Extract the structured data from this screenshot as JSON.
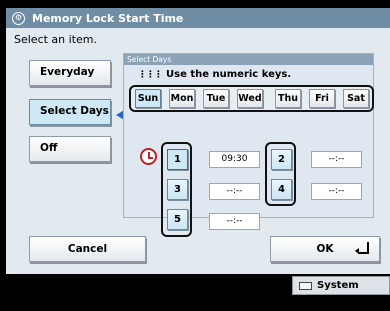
{
  "window": {
    "title": "Memory Lock Start Time"
  },
  "instruction": "Select an item.",
  "modes": [
    {
      "label": "Everyday",
      "selected": false
    },
    {
      "label": "Select Days",
      "selected": true
    },
    {
      "label": "Off",
      "selected": false
    }
  ],
  "select_days": {
    "header": "Select Days",
    "hint": "Use the numeric keys.",
    "days": [
      {
        "label": "Sun",
        "selected": true
      },
      {
        "label": "Mon",
        "selected": false
      },
      {
        "label": "Tue",
        "selected": false
      },
      {
        "label": "Wed",
        "selected": false
      },
      {
        "label": "Thu",
        "selected": false
      },
      {
        "label": "Fri",
        "selected": false
      },
      {
        "label": "Sat",
        "selected": false
      }
    ],
    "slots": [
      {
        "number": "1",
        "time": "09:30",
        "active": true
      },
      {
        "number": "2",
        "time": "--:--",
        "active": false
      },
      {
        "number": "3",
        "time": "--:--",
        "active": false
      },
      {
        "number": "4",
        "time": "--:--",
        "active": false
      },
      {
        "number": "5",
        "time": "--:--",
        "active": false
      }
    ]
  },
  "buttons": {
    "cancel": "Cancel",
    "ok": "OK"
  },
  "statusbar": {
    "system_monitor": "System Monitor"
  },
  "icons": {
    "title": "lock-clock-icon",
    "keypad": "keypad-icon",
    "clock": "clock-icon",
    "ok_return": "return-icon",
    "monitor": "monitor-icon"
  },
  "colors": {
    "title_bar": "#6f8ea6",
    "panel": "#e2eaf0",
    "selected_button": "#cfe8f6",
    "pointer_arrow": "#2a68c4",
    "clock": "#c0202a"
  }
}
